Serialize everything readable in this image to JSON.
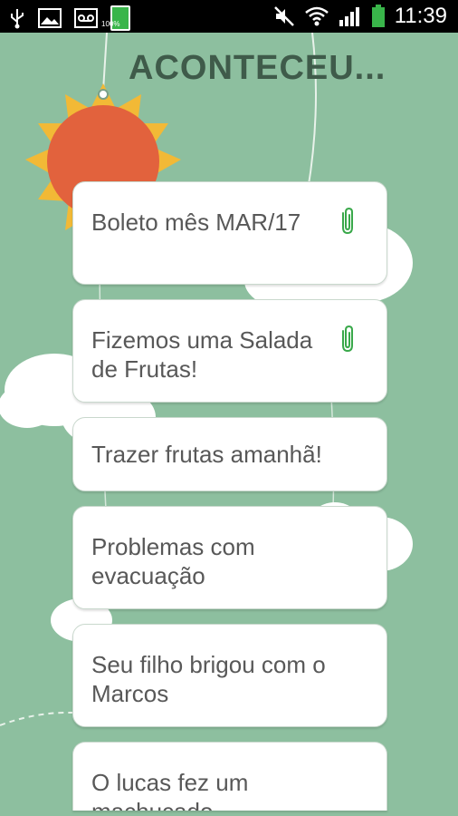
{
  "status_bar": {
    "time": "11:39",
    "battery_small_label": "100%",
    "icons": [
      "usb-icon",
      "image-icon",
      "voicemail-icon",
      "battery-icon",
      "mute-icon",
      "wifi-icon",
      "signal-icon",
      "battery-icon"
    ]
  },
  "header": {
    "title": "ACONTECEU..."
  },
  "items": [
    {
      "label": "Boleto mês MAR/17",
      "attachment": true
    },
    {
      "label": "Fizemos uma Salada de Frutas!",
      "attachment": true
    },
    {
      "label": "Trazer frutas amanhã!",
      "attachment": false
    },
    {
      "label": "Problemas com evacuação",
      "attachment": false
    },
    {
      "label": "Seu filho brigou com o Marcos",
      "attachment": false
    },
    {
      "label": "O lucas fez um machucado",
      "attachment": false
    }
  ],
  "colors": {
    "background": "#8dbf9f",
    "accent": "#39a84a",
    "title": "#3f5b4a"
  }
}
